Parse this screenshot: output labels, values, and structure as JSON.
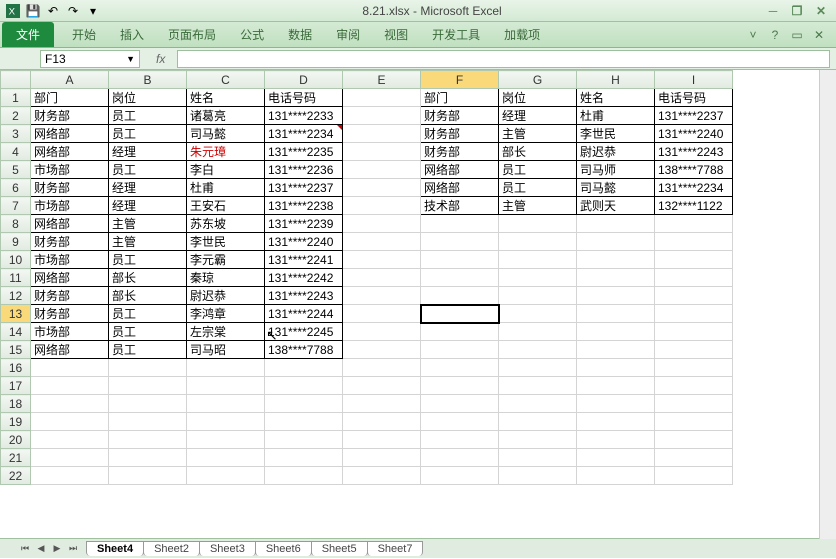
{
  "title": "8.21.xlsx - Microsoft Excel",
  "qat": {
    "save": "💾",
    "undo": "↶",
    "redo": "↷"
  },
  "win": {
    "min": "─",
    "restore": "❐",
    "close": "✕"
  },
  "tabs": {
    "file": "文件",
    "items": [
      "开始",
      "插入",
      "页面布局",
      "公式",
      "数据",
      "审阅",
      "视图",
      "开发工具",
      "加载项"
    ]
  },
  "ribbon_right": {
    "minimize": "˅",
    "help": "?",
    "expand": "▭",
    "close": "✕"
  },
  "fx": {
    "cell": "F13",
    "label": "fx"
  },
  "columns": [
    "A",
    "B",
    "C",
    "D",
    "E",
    "F",
    "G",
    "H",
    "I"
  ],
  "rows": [
    1,
    2,
    3,
    4,
    5,
    6,
    7,
    8,
    9,
    10,
    11,
    12,
    13,
    14,
    15,
    16,
    17,
    18,
    19,
    20,
    21,
    22
  ],
  "left": {
    "header": [
      "部门",
      "岗位",
      "姓名",
      "电话号码"
    ],
    "data": [
      [
        "财务部",
        "员工",
        "诸葛亮",
        "131****2233"
      ],
      [
        "网络部",
        "员工",
        "司马懿",
        "131****2234"
      ],
      [
        "网络部",
        "经理",
        "朱元璋",
        "131****2235"
      ],
      [
        "市场部",
        "员工",
        "李白",
        "131****2236"
      ],
      [
        "财务部",
        "经理",
        "杜甫",
        "131****2237"
      ],
      [
        "市场部",
        "经理",
        "王安石",
        "131****2238"
      ],
      [
        "网络部",
        "主管",
        "苏东坡",
        "131****2239"
      ],
      [
        "财务部",
        "主管",
        "李世民",
        "131****2240"
      ],
      [
        "市场部",
        "员工",
        "李元霸",
        "131****2241"
      ],
      [
        "网络部",
        "部长",
        "秦琼",
        "131****2242"
      ],
      [
        "财务部",
        "部长",
        "尉迟恭",
        "131****2243"
      ],
      [
        "财务部",
        "员工",
        "李鸿章",
        "131****2244"
      ],
      [
        "市场部",
        "员工",
        "左宗棠",
        "131****2245"
      ],
      [
        "网络部",
        "员工",
        "司马昭",
        "138****7788"
      ]
    ],
    "red_cells": [
      [
        4,
        2
      ]
    ]
  },
  "right": {
    "header": [
      "部门",
      "岗位",
      "姓名",
      "电话号码"
    ],
    "data": [
      [
        "财务部",
        "经理",
        "杜甫",
        "131****2237"
      ],
      [
        "财务部",
        "主管",
        "李世民",
        "131****2240"
      ],
      [
        "财务部",
        "部长",
        "尉迟恭",
        "131****2243"
      ],
      [
        "网络部",
        "员工",
        "司马师",
        "138****7788"
      ],
      [
        "网络部",
        "员工",
        "司马懿",
        "131****2234"
      ],
      [
        "技术部",
        "主管",
        "武则天",
        "132****1122"
      ]
    ]
  },
  "active_cell": {
    "row": 13,
    "col": "F"
  },
  "highlight": {
    "row": 13,
    "col": "F"
  },
  "sheets": {
    "items": [
      "Sheet4",
      "Sheet2",
      "Sheet3",
      "Sheet6",
      "Sheet5",
      "Sheet7"
    ],
    "active": 0
  },
  "comment_at": {
    "row": 3,
    "col": "D"
  }
}
